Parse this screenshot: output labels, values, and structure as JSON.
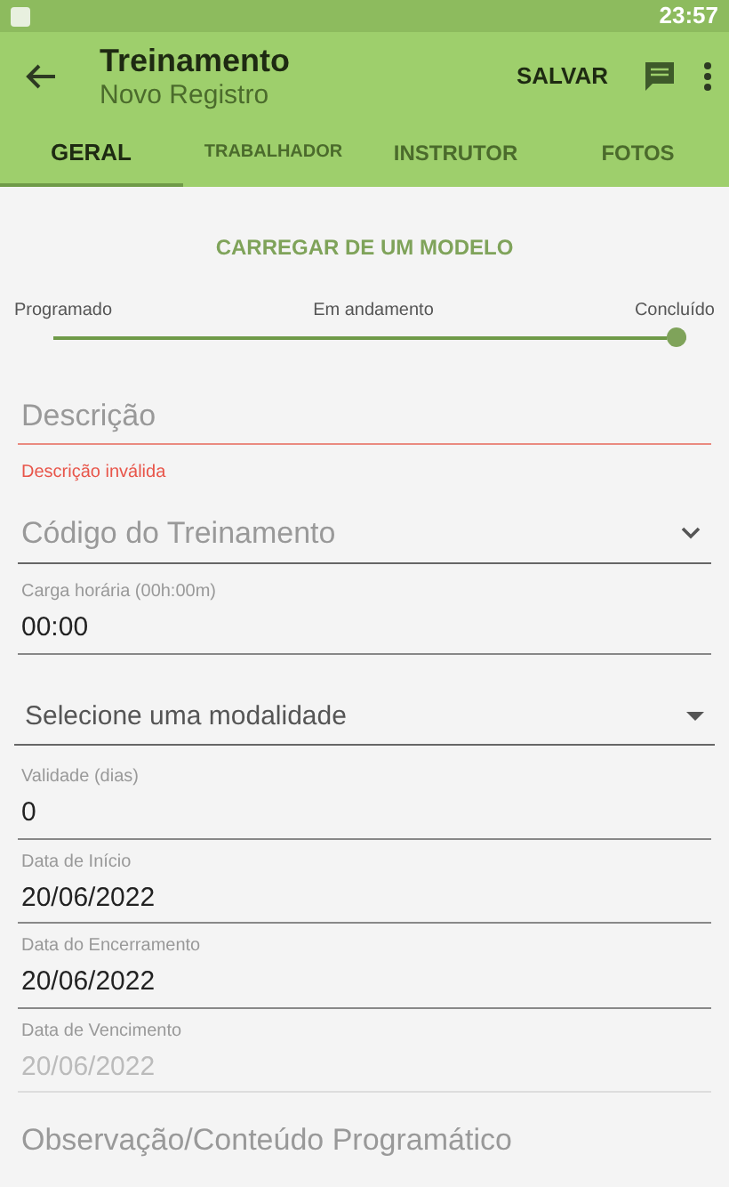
{
  "status_bar": {
    "time": "23:57"
  },
  "app_bar": {
    "title": "Treinamento",
    "subtitle": "Novo Registro",
    "action": "SALVAR"
  },
  "tabs": [
    {
      "label": "GERAL",
      "selected": true
    },
    {
      "label": "TRABALHADOR",
      "selected": false
    },
    {
      "label": "INSTRUTOR",
      "selected": false
    },
    {
      "label": "FOTOS",
      "selected": false
    }
  ],
  "load_template": "CARREGAR DE UM MODELO",
  "status_slider": {
    "stops": [
      "Programado",
      "Em andamento",
      "Concluído"
    ],
    "level": 1
  },
  "fields": [
    {
      "kind": "text",
      "placeholder": "Descrição",
      "error": "Descrição inválida"
    },
    {
      "kind": "dropdown",
      "placeholder": "Código do Treinamento"
    },
    {
      "kind": "input",
      "label": "Carga horária (00h:00m)",
      "value": "00:00",
      "disabled": false
    },
    {
      "kind": "select",
      "placeholder": "Selecione uma modalidade"
    },
    {
      "kind": "input",
      "label": "Validade (dias)",
      "value": "0",
      "disabled": false
    },
    {
      "kind": "input",
      "label": "Data de Início",
      "value": "20/06/2022",
      "disabled": false
    },
    {
      "kind": "input",
      "label": "Data do Encerramento",
      "value": "20/06/2022",
      "disabled": false
    },
    {
      "kind": "input",
      "label": "Data de Vencimento",
      "value": "20/06/2022",
      "disabled": true
    },
    {
      "kind": "text",
      "placeholder": "Observação/Conteúdo Programático"
    }
  ]
}
